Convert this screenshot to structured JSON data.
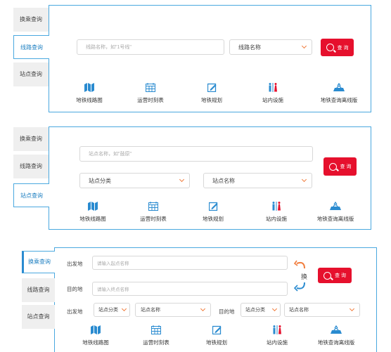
{
  "tabs": {
    "transfer": "换乘查询",
    "line": "线路查询",
    "station": "站点查询"
  },
  "section1": {
    "line_input_placeholder": "线路名称，如\"1号线\"",
    "line_select": "线路名称",
    "query_label": "查 询"
  },
  "section2": {
    "station_input_placeholder": "站点名称，如\"鼓原\"",
    "category_select": "站点分类",
    "station_select": "站点名称",
    "query_label": "查 询"
  },
  "section3": {
    "from_label": "出发地",
    "from_placeholder": "请输入起点名称",
    "to_label": "目的地",
    "to_placeholder": "请输入终点名称",
    "swap_label": "换",
    "query_label": "查 询",
    "from_label2": "出发地",
    "from_category": "站点分类",
    "from_station": "站点名称",
    "to_label2": "目的地",
    "to_category": "站点分类",
    "to_station": "站点名称"
  },
  "features": [
    {
      "label": "地铁线路图",
      "icon": "map-icon"
    },
    {
      "label": "运营时刻表",
      "icon": "calendar-icon"
    },
    {
      "label": "地铁规划",
      "icon": "edit-icon"
    },
    {
      "label": "站内设施",
      "icon": "restroom-icon"
    },
    {
      "label": "地铁查询离线版",
      "icon": "offline-icon"
    }
  ],
  "colors": {
    "accent": "#4aa8df",
    "button": "#e6102d",
    "icon": "#2a8bd0",
    "chevron": "#f17c3c"
  }
}
